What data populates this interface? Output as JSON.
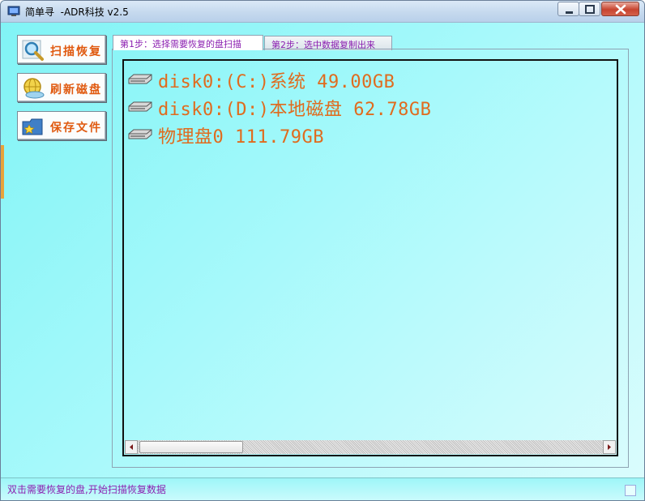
{
  "window": {
    "title": "简单寻  -ADR科技 v2.5"
  },
  "sidebar": {
    "items": [
      {
        "label": "扫描恢复",
        "icon": "magnifier-icon"
      },
      {
        "label": "刷新磁盘",
        "icon": "globe-refresh-icon"
      },
      {
        "label": "保存文件",
        "icon": "folder-star-icon"
      }
    ]
  },
  "tabs": [
    {
      "label": "第1步：选择需要恢复的盘扫描",
      "active": true
    },
    {
      "label": "第2步：选中数据复制出来",
      "active": false
    }
  ],
  "disks": [
    {
      "label": "disk0:(C:)系统 49.00GB",
      "icon": "hard-drive-icon"
    },
    {
      "label": "disk0:(D:)本地磁盘 62.78GB",
      "icon": "hard-drive-icon"
    },
    {
      "label": "物理盘0 111.79GB",
      "icon": "hard-drive-icon"
    }
  ],
  "status": {
    "text": "双击需要恢复的盘,开始扫描恢复数据"
  },
  "colors": {
    "accent_text": "#e06b1e",
    "tab_text": "#8b1fb0",
    "background": "#a6f9fb"
  }
}
